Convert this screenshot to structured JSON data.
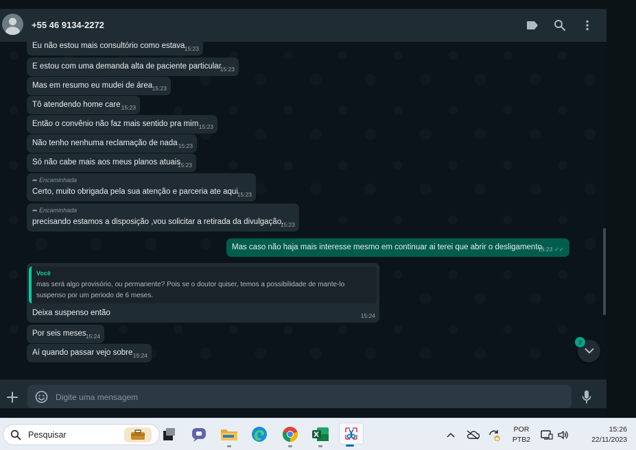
{
  "header": {
    "contact_name": "+55 46 9134-2272",
    "icons": [
      "avatar",
      "label-icon",
      "search-icon",
      "menu-icon"
    ]
  },
  "messages": [
    {
      "direction": "in",
      "text": "Eu não estou mais consultório como estava",
      "time": "15:23"
    },
    {
      "direction": "in",
      "text": "E estou com uma demanda alta de paciente particular",
      "time": "15:23"
    },
    {
      "direction": "in",
      "text": "Mas em resumo eu mudei de área",
      "time": "15:23"
    },
    {
      "direction": "in",
      "text": "Tô atendendo home care",
      "time": "15:23"
    },
    {
      "direction": "in",
      "text": "Então o convênio não faz mais sentido pra mim",
      "time": "15:23"
    },
    {
      "direction": "in",
      "text": "Não tenho nenhuma reclamação de nada",
      "time": "15:23"
    },
    {
      "direction": "in",
      "text": "Só não cabe mais aos meus planos atuais",
      "time": "15:23"
    },
    {
      "direction": "in",
      "forwarded_label": "Encaminhada",
      "text": "Certo, muito obrigada pela sua atenção e parceria ate aqui",
      "time": "15:23"
    },
    {
      "direction": "in",
      "forwarded_label": "Encaminhada",
      "text": "precisando estamos a disposição ,vou solicitar a retirada da divulgação.",
      "time": "15:23"
    },
    {
      "direction": "out",
      "text": "Mas caso não haja mais interesse mesmo em continuar ai terei que abrir o desligamento.",
      "time": "15:23",
      "status": "read"
    },
    {
      "direction": "in",
      "quote_author": "Você",
      "quote_text": "mas será algo provisório, ou permanente? Pois se o doutor quiser, temos a possibilidade de mante-lo suspenso por um periodo de 6 meses.",
      "text": "Deixa suspenso então",
      "time": "15:24"
    },
    {
      "direction": "in",
      "text": "Por seis meses",
      "time": "15:24"
    },
    {
      "direction": "in",
      "text": "Aí quando passar vejo sobre",
      "time": "15:24"
    }
  ],
  "scroll_down": {
    "unread_count": "2"
  },
  "composer": {
    "placeholder": "Digite uma mensagem",
    "icons": [
      "attach-icon",
      "emoji-icon",
      "mic-icon"
    ]
  },
  "taskbar": {
    "search_label": "Pesquisar",
    "apps": [
      "folder-briefcase-icon",
      "task-view-icon",
      "teams-chat-icon",
      "file-explorer-icon",
      "edge-icon",
      "chrome-icon",
      "excel-icon",
      "snipping-tool-icon"
    ],
    "tray_icons": [
      "chevron-up-icon",
      "network-off-icon",
      "sync-icon",
      "display-icon",
      "volume-icon"
    ],
    "language_line1": "POR",
    "language_line2": "PTB2",
    "time": "15:26",
    "date": "22/11/2023"
  },
  "colors": {
    "header_bg": "#202c33",
    "chat_bg": "#0b141a",
    "incoming_bubble": "#202c33",
    "outgoing_bubble": "#005c4b",
    "accent": "#00a884",
    "taskbar_bg": "#e9eef4"
  }
}
